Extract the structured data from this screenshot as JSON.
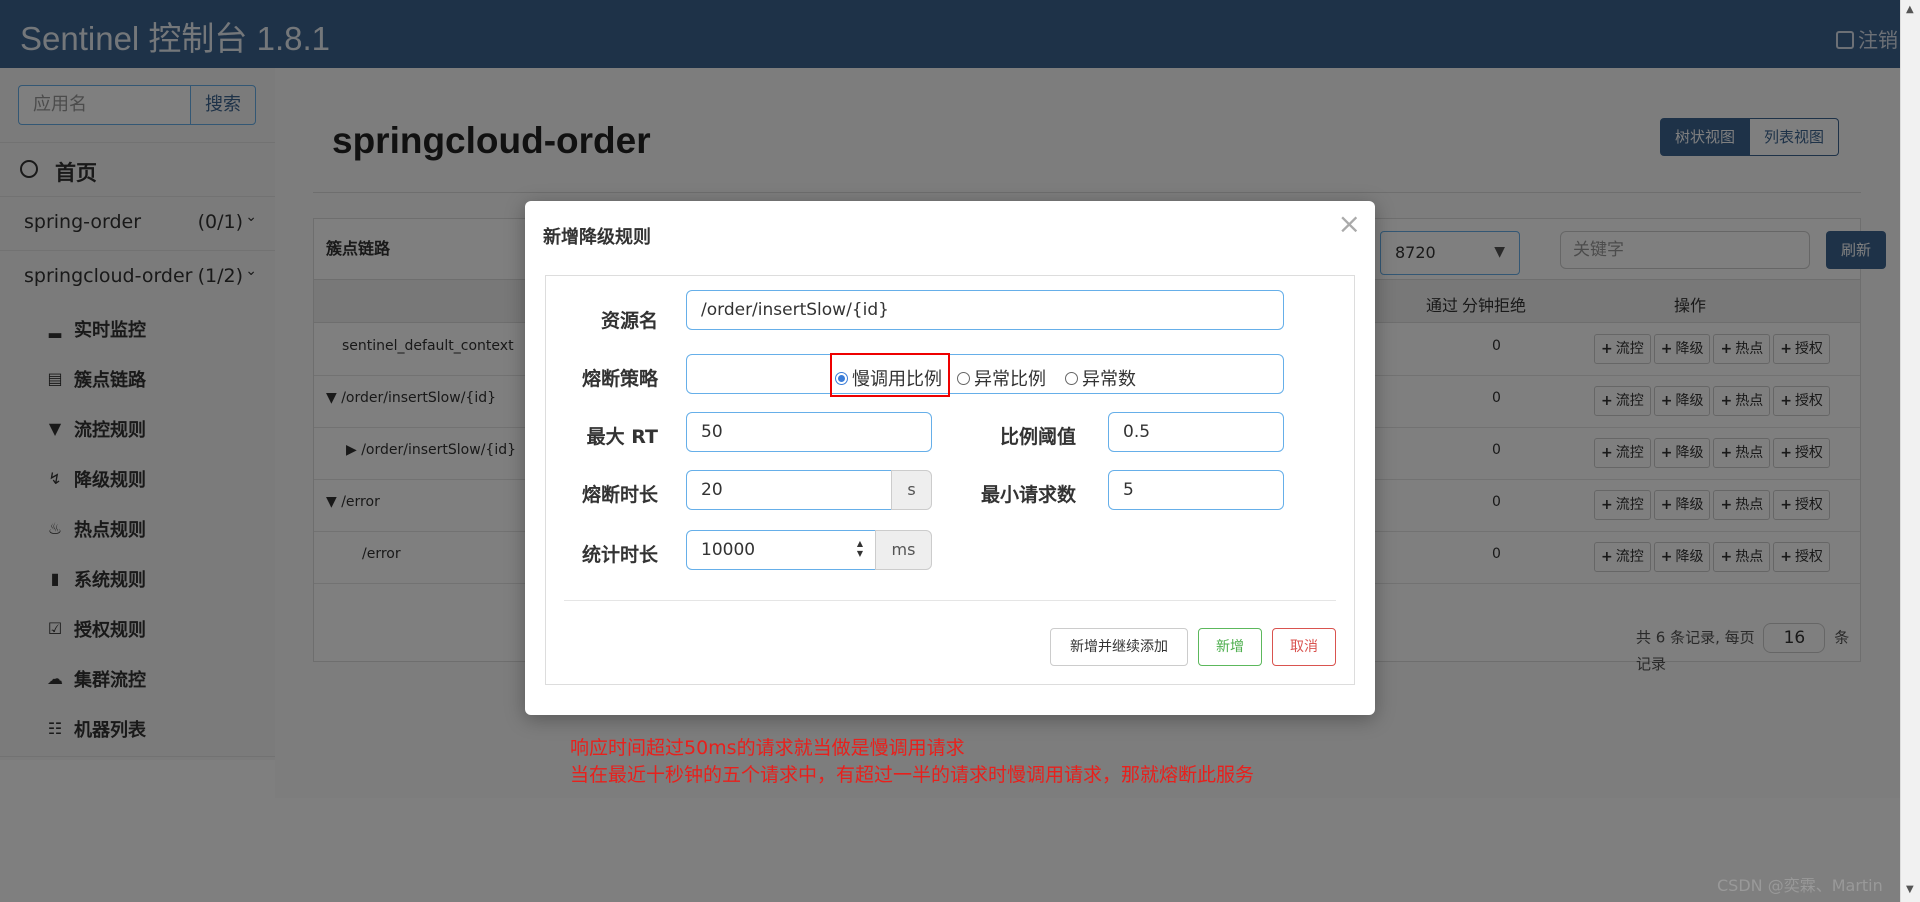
{
  "header": {
    "title": "Sentinel 控制台 1.8.1",
    "logout": "注销"
  },
  "sidebar": {
    "search_placeholder": "应用名",
    "search_button": "搜索",
    "home": "首页",
    "apps": [
      {
        "name": "spring-order",
        "count": "(0/1)"
      },
      {
        "name": "springcloud-order",
        "count": "(1/2)"
      }
    ],
    "menu": [
      {
        "label": "实时监控",
        "icon": "bar-chart-icon"
      },
      {
        "label": "簇点链路",
        "icon": "list-icon"
      },
      {
        "label": "流控规则",
        "icon": "filter-icon"
      },
      {
        "label": "降级规则",
        "icon": "flash-icon"
      },
      {
        "label": "热点规则",
        "icon": "fire-icon"
      },
      {
        "label": "系统规则",
        "icon": "lock-icon"
      },
      {
        "label": "授权规则",
        "icon": "check-icon"
      },
      {
        "label": "集群流控",
        "icon": "cloud-icon"
      },
      {
        "label": "机器列表",
        "icon": "th-list-icon"
      }
    ]
  },
  "main": {
    "title": "springcloud-order",
    "view_tree": "树状视图",
    "view_list": "列表视图",
    "panel_title": "簇点链路",
    "ip_select": "8720",
    "keyword_placeholder": "关键字",
    "refresh": "刷新",
    "col_pass": "通过",
    "col_block": "分钟拒绝",
    "col_ops": "操作",
    "ops": [
      "流控",
      "降级",
      "热点",
      "授权"
    ],
    "rows": [
      {
        "resource": "sentinel_default_context",
        "block": "0"
      },
      {
        "resource": "/order/insertSlow/{id}",
        "block": "0"
      },
      {
        "resource": "/order/insertSlow/{id}",
        "block": "0"
      },
      {
        "resource": "/error",
        "block": "0"
      },
      {
        "resource": "/error",
        "block": "0"
      }
    ],
    "pager_prefix": "共 6 条记录, 每页",
    "pager_size": "16",
    "pager_suffix": "条记录"
  },
  "modal": {
    "title": "新增降级规则",
    "close": "×",
    "resource_label": "资源名",
    "resource_value": "/order/insertSlow/{id}",
    "strategy_label": "熔断策略",
    "strategies": [
      "慢调用比例",
      "异常比例",
      "异常数"
    ],
    "max_rt_label": "最大 RT",
    "max_rt_value": "50",
    "ratio_label": "比例阈值",
    "ratio_value": "0.5",
    "duration_label": "熔断时长",
    "duration_value": "20",
    "duration_unit": "s",
    "min_req_label": "最小请求数",
    "min_req_value": "5",
    "stat_label": "统计时长",
    "stat_value": "10000",
    "stat_unit": "ms",
    "btn_add_continue": "新增并继续添加",
    "btn_add": "新增",
    "btn_cancel": "取消"
  },
  "annotation": {
    "line1": "响应时间超过50ms的请求就当做是慢调用请求",
    "line2": "当在最近十秒钟的五个请求中，有超过一半的请求时慢调用请求，那就熔断此服务"
  },
  "watermark": "CSDN @奕霖、Martin"
}
